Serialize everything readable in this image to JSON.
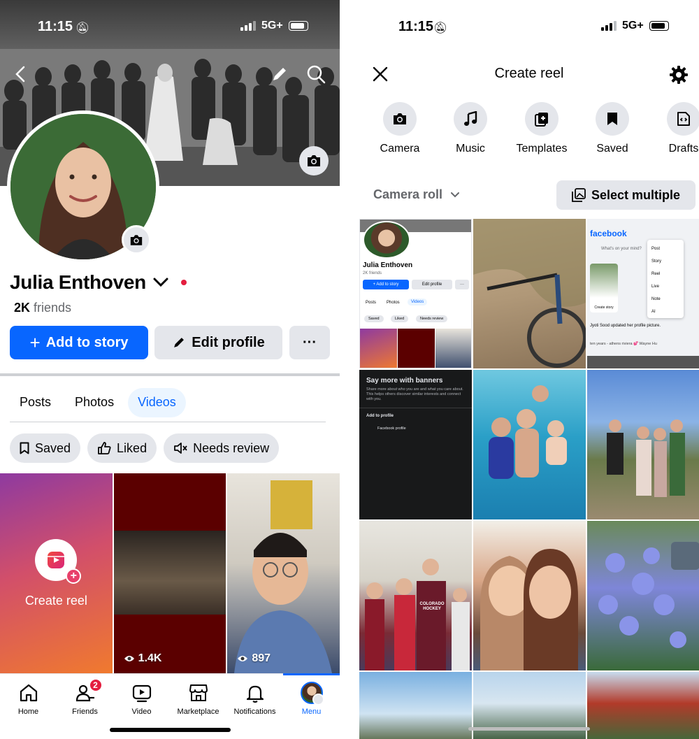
{
  "left": {
    "status": {
      "time": "11:15",
      "network": "5G+"
    },
    "profile": {
      "name": "Julia Enthoven",
      "friends_count": "2K",
      "friends_label": "friends"
    },
    "buttons": {
      "add_story": "Add to story",
      "edit_profile": "Edit profile",
      "more": "···"
    },
    "tabs": [
      {
        "label": "Posts",
        "active": false
      },
      {
        "label": "Photos",
        "active": false
      },
      {
        "label": "Videos",
        "active": true
      }
    ],
    "filters": [
      {
        "label": "Saved",
        "icon": "bookmark-icon"
      },
      {
        "label": "Liked",
        "icon": "thumbs-up-icon"
      },
      {
        "label": "Needs review",
        "icon": "muted-speaker-icon"
      }
    ],
    "videos": [
      {
        "label": "Create reel",
        "icon": "reel-icon"
      },
      {
        "views": "1.4K"
      },
      {
        "views": "897"
      }
    ],
    "nav": [
      {
        "label": "Home",
        "icon": "home-icon",
        "badge": ""
      },
      {
        "label": "Friends",
        "icon": "friends-icon",
        "badge": "2"
      },
      {
        "label": "Video",
        "icon": "video-icon",
        "badge": ""
      },
      {
        "label": "Marketplace",
        "icon": "marketplace-icon",
        "badge": ""
      },
      {
        "label": "Notifications",
        "icon": "bell-icon",
        "badge": ""
      },
      {
        "label": "Menu",
        "icon": "menu-avatar",
        "badge": "",
        "active": true
      }
    ]
  },
  "right": {
    "status": {
      "time": "11:15",
      "network": "5G+"
    },
    "header": {
      "title": "Create reel"
    },
    "tools": [
      {
        "label": "Camera",
        "icon": "camera-icon"
      },
      {
        "label": "Music",
        "icon": "music-note-icon"
      },
      {
        "label": "Templates",
        "icon": "templates-icon"
      },
      {
        "label": "Saved",
        "icon": "bookmark-icon"
      },
      {
        "label": "Drafts",
        "icon": "drafts-icon"
      }
    ],
    "gallery": {
      "source_label": "Camera roll",
      "select_multiple": "Select multiple"
    },
    "thumbnails": {
      "profile_screenshot": {
        "name": "Julia Enthoven",
        "friends": "2K friends",
        "add_story": "+ Add to story",
        "edit_profile": "Edit profile",
        "more": "···",
        "tabs": [
          "Posts",
          "Photos",
          "Videos"
        ],
        "filters": [
          "Saved",
          "Liked",
          "Needs review"
        ]
      },
      "facebook_screenshot": {
        "logo": "facebook",
        "prompt": "What's on your mind?",
        "menu": [
          "Post",
          "Story",
          "Reel",
          "Live",
          "Note",
          "AI"
        ],
        "create_story": "Create story",
        "update_text": "Jyoti Sood updated her profile picture.",
        "caption": "ten years - athens riviera 💕 Wayne Hu"
      },
      "banner_screenshot": {
        "title": "Say more with banners",
        "body": "Share more about who you are and what you care about. This helps others discover similar interests and connect with you.",
        "add_to_profile": "Add to profile",
        "option": "Facebook profile"
      },
      "hockey_shirt": "COLORADO HOCKEY"
    }
  },
  "colors": {
    "brand_blue": "#0866ff",
    "chip_gray": "#e4e6eb",
    "badge_red": "#e41e3f",
    "text_secondary": "#65676b"
  }
}
